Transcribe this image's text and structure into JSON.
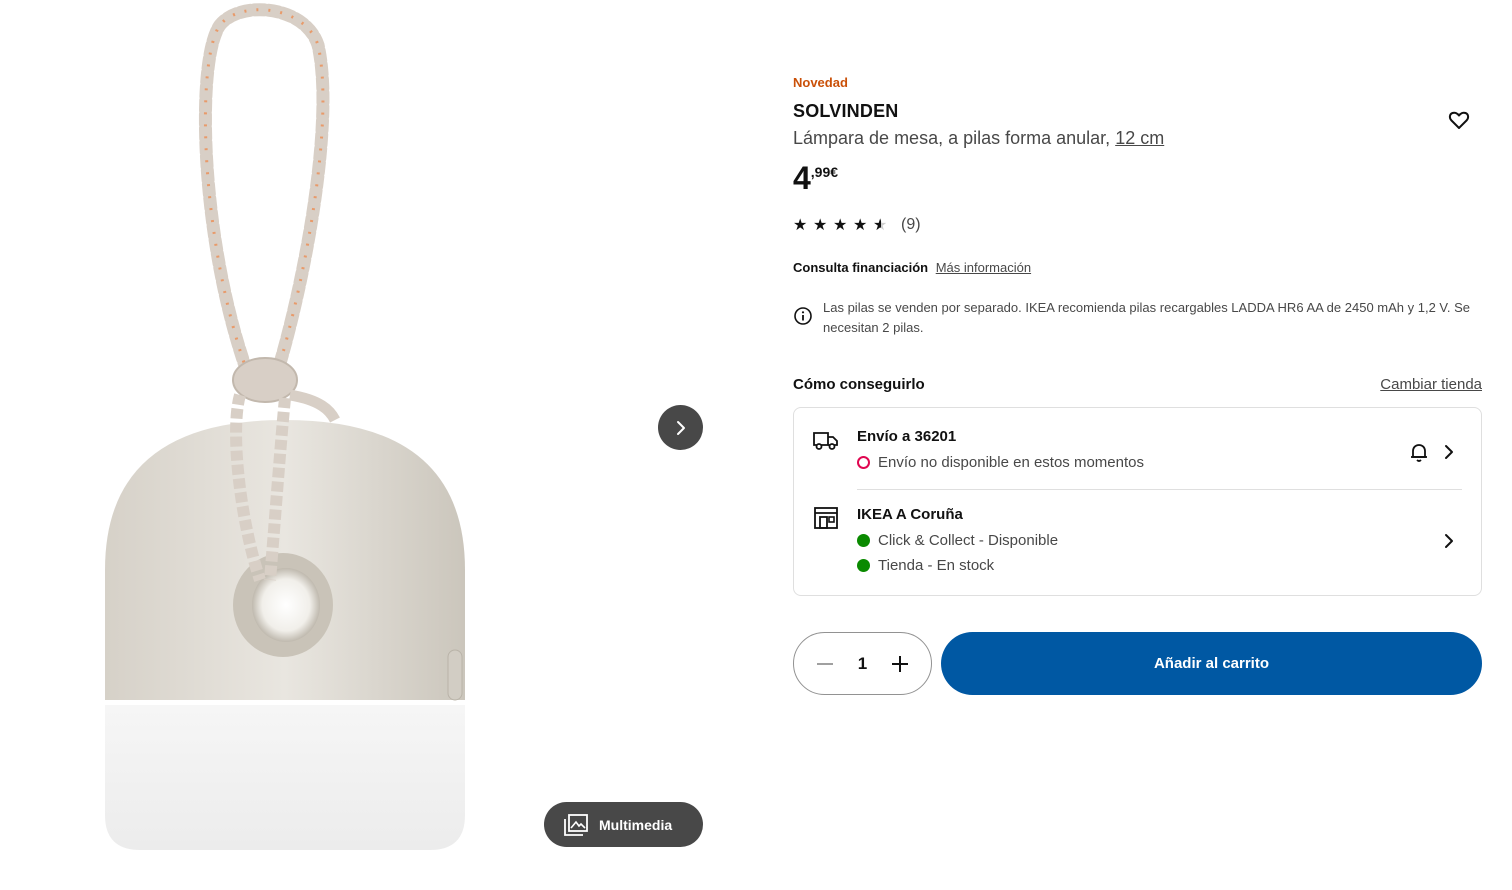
{
  "product": {
    "badge": "Novedad",
    "name": "SOLVINDEN",
    "description": "Lámpara de mesa, a pilas forma anular,",
    "size": "12 cm",
    "price_int": "4",
    "price_dec": ",99€",
    "rating_value": 4.5,
    "rating_max": 5,
    "review_count": "(9)",
    "image_icon": "ring-lamp-with-cord"
  },
  "finance": {
    "label": "Consulta financiación",
    "link": "Más información"
  },
  "notice": {
    "icon": "info-icon",
    "text": "Las pilas se venden por separado. IKEA recomienda pilas recargables LADDA HR6 AA de 2450 mAh y 1,2 V. Se necesitan 2 pilas."
  },
  "availability": {
    "title": "Cómo conseguirlo",
    "change_store": "Cambiar tienda",
    "delivery": {
      "icon": "truck-icon",
      "heading": "Envío a 36201",
      "status": "Envío no disponible en estos momentos",
      "status_color": "#e00751"
    },
    "store": {
      "icon": "store-icon",
      "heading": "IKEA A Coruña",
      "click_collect": "Click & Collect - Disponible",
      "in_store": "Tienda - En stock",
      "status_color": "#0a8a00"
    }
  },
  "cart": {
    "quantity": "1",
    "add_label": "Añadir al carrito",
    "button_color": "#0058a3"
  },
  "media": {
    "multimedia_label": "Multimedia"
  },
  "colors": {
    "badge": "#ca5008",
    "text": "#111111",
    "secondary_text": "#484848",
    "dark_button": "#484848"
  }
}
